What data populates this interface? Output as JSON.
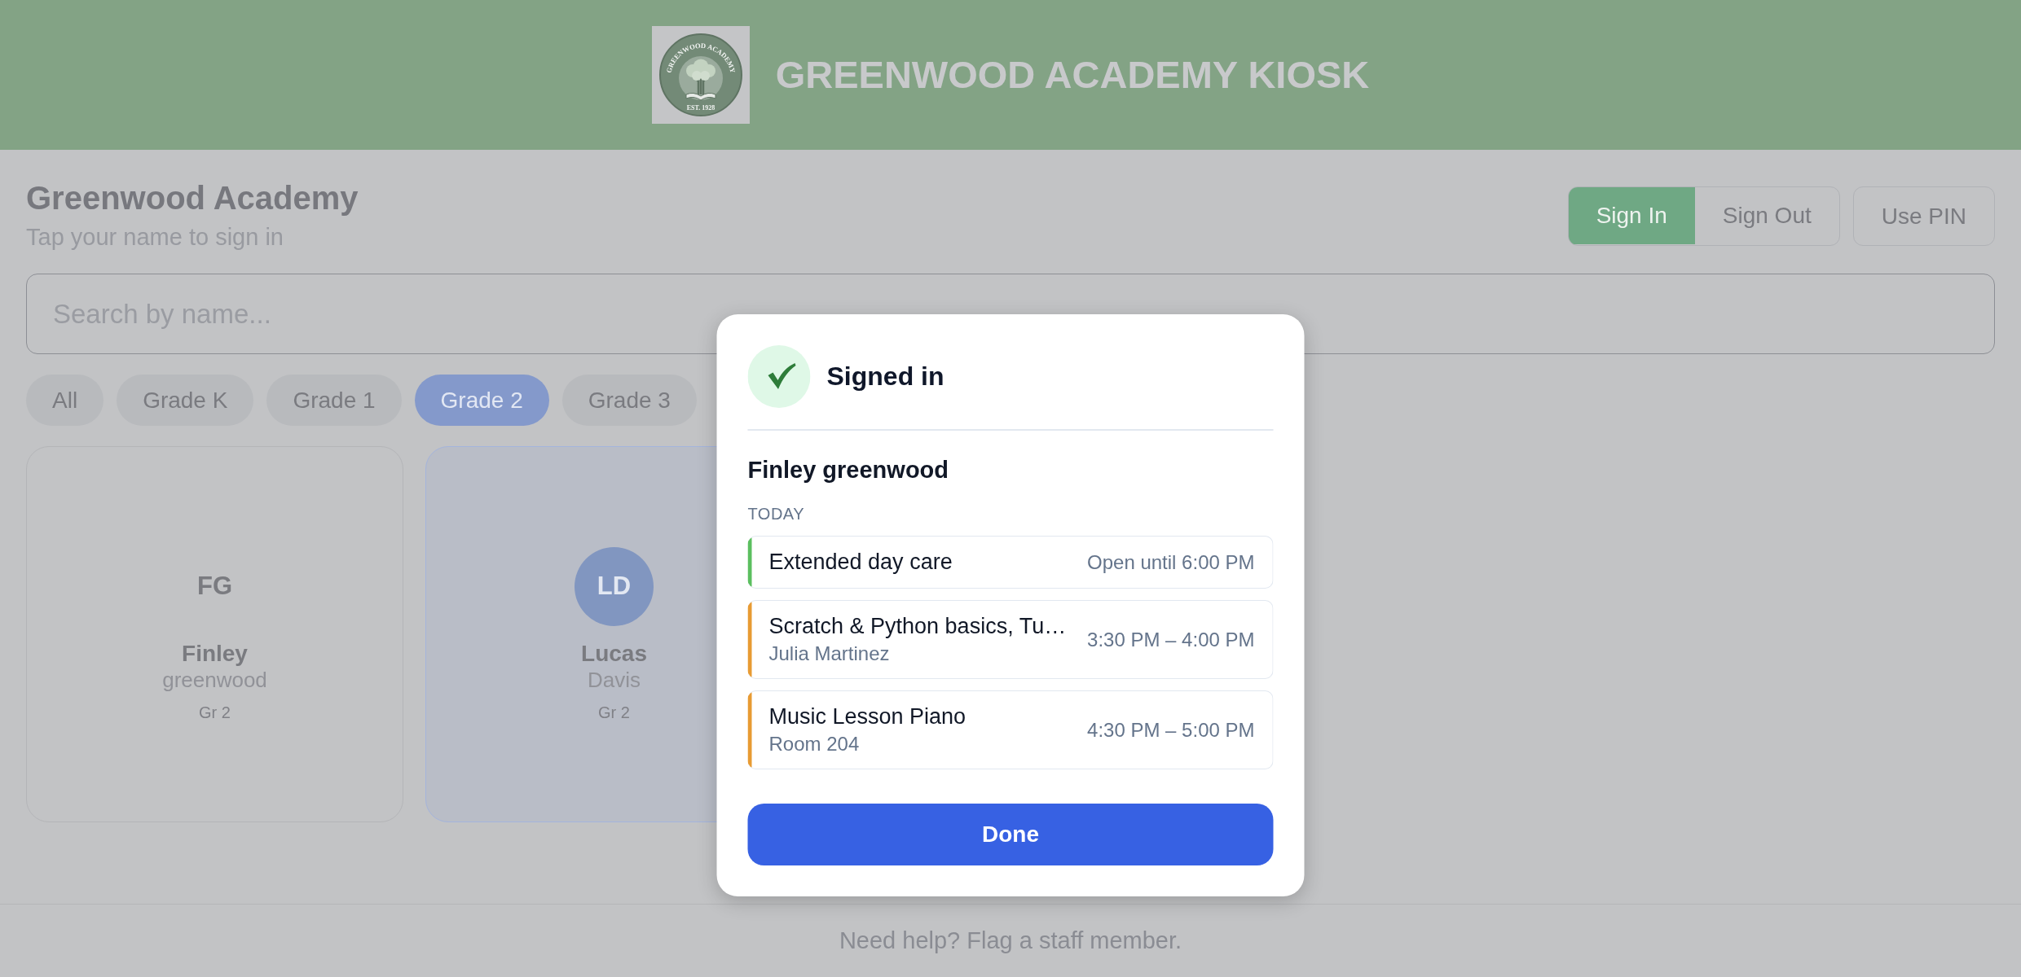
{
  "header": {
    "title": "GREENWOOD ACADEMY KIOSK",
    "logo": {
      "ring_text": "GREENWOOD ACADEMY",
      "est_text": "EST. 1928"
    }
  },
  "page": {
    "title": "Greenwood Academy",
    "subtitle": "Tap your name to sign in"
  },
  "mode_toggle": [
    {
      "label": "Sign In",
      "selected": true
    },
    {
      "label": "Sign Out",
      "selected": false
    }
  ],
  "pin_button": {
    "label": "Use PIN"
  },
  "search": {
    "placeholder": "Search by name..."
  },
  "grade_filters": [
    {
      "label": "All",
      "selected": false
    },
    {
      "label": "Grade K",
      "selected": false
    },
    {
      "label": "Grade 1",
      "selected": false
    },
    {
      "label": "Grade 2",
      "selected": true
    },
    {
      "label": "Grade 3",
      "selected": false
    }
  ],
  "students": [
    {
      "initials": "FG",
      "first_name": "Finley",
      "last_name": "greenwood",
      "grade": "Gr 2",
      "selected": false
    },
    {
      "initials": "LD",
      "first_name": "Lucas",
      "last_name": "Davis",
      "grade": "Gr 2",
      "selected": true,
      "color": "#8196c0"
    }
  ],
  "dialog": {
    "title": "Signed in",
    "student_name": "Finley greenwood",
    "section_label": "TODAY",
    "schedule": [
      {
        "title": "Extended day care",
        "time": "Open until 6:00 PM",
        "color": "#5bbf5f"
      },
      {
        "title": "Scratch & Python basics, Tu…",
        "detail": "Julia Martinez",
        "time": "3:30 PM – 4:00 PM",
        "color": "#e89b33"
      },
      {
        "title": "Music Lesson Piano",
        "detail": "Room 204",
        "time": "4:30 PM – 5:00 PM",
        "color": "#e89b33"
      }
    ],
    "done_button": {
      "label": "Done"
    }
  },
  "footer": {
    "text": "Need help? Flag a staff member."
  }
}
